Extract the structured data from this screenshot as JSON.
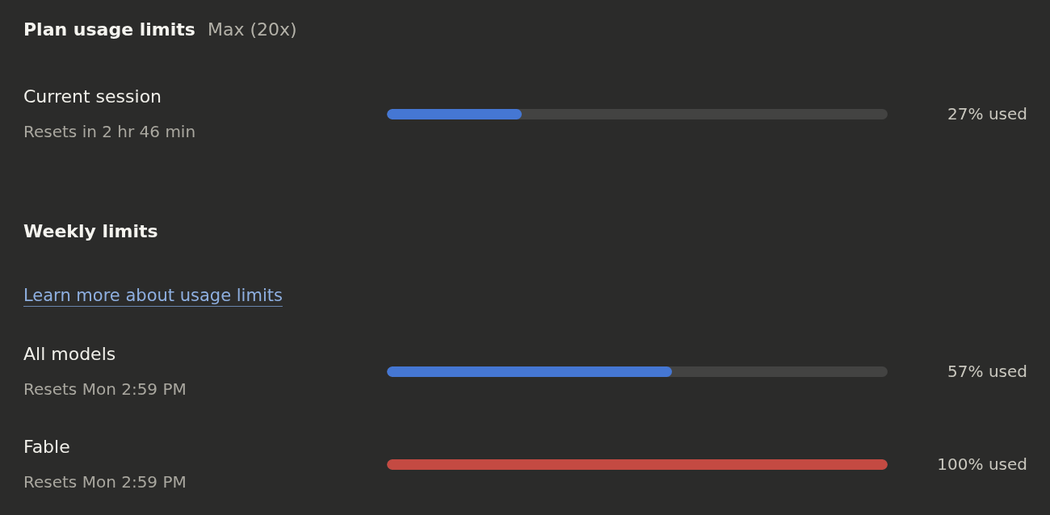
{
  "header": {
    "title": "Plan usage limits",
    "plan": "Max (20x)"
  },
  "session": {
    "label": "Current session",
    "resets": "Resets in 2 hr 46 min",
    "level": 0.27,
    "reading": "27% used",
    "color": "#4577d3"
  },
  "weekly": {
    "heading": "Weekly limits",
    "link": "Learn more about usage limits",
    "limits": [
      {
        "label": "All models",
        "resets": "Resets Mon 2:59 PM",
        "level": 0.57,
        "reading": "57% used",
        "color": "#4577d3"
      },
      {
        "label": "Fable",
        "resets": "Resets Mon 2:59 PM",
        "level": 1,
        "reading": "100% used",
        "color": "#c44a42"
      }
    ]
  }
}
